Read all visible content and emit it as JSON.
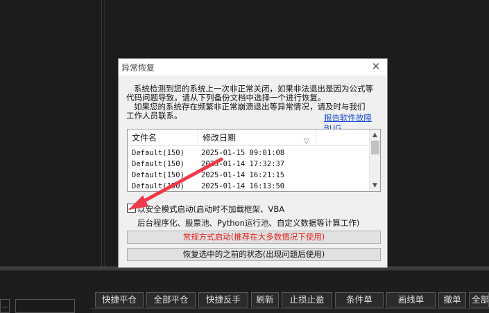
{
  "dialog": {
    "title": "异常恢复",
    "message_line1": "系统检测到您的系统上一次非正常关闭，如果非法退出是因为公式等",
    "message_line2": "代码问题导致，请从下列备份文档中选择一个进行恢复。",
    "message_line3": "如果您的系统存在频繁非正常崩溃退出等异常情况，请及时与我们",
    "message_line4": "工作人员联系。",
    "report_link": "报告软件故障BUG",
    "file_list": {
      "columns": [
        "文件名",
        "修改日期"
      ],
      "sort_icon": "sort-descending-icon",
      "rows": [
        {
          "name": "Default(150)",
          "date": "2025-01-15 09:01:08"
        },
        {
          "name": "Default(150)",
          "date": "2025-01-14 17:32:37"
        },
        {
          "name": "Default(150)",
          "date": "2025-01-14 16:21:15"
        },
        {
          "name": "Default(150)",
          "date": "2025-01-14 16:13:50"
        }
      ]
    },
    "safe_mode": {
      "checked": true,
      "label_line1": "以安全模式启动(启动时不加载框架、VBA",
      "label_line2": "后台程序化、股票池、Python运行池、自定义数据等计算工作)"
    },
    "normal_start_button": "常规方式启动(推荐在大多数情况下使用)",
    "restore_button": "恢复选中的之前的状态(出现问题后使用)",
    "colors": {
      "normal_start_text": "#e0201c",
      "link": "#1a4fd6",
      "arrow": "#f03a4a"
    }
  },
  "toolbar": {
    "buttons": [
      "快捷平仓",
      "全部平仓",
      "快捷反手",
      "刷新",
      "止损止盈",
      "条件单",
      "画线单",
      "撤单",
      "全部撤单"
    ],
    "left_box_text": "..."
  }
}
